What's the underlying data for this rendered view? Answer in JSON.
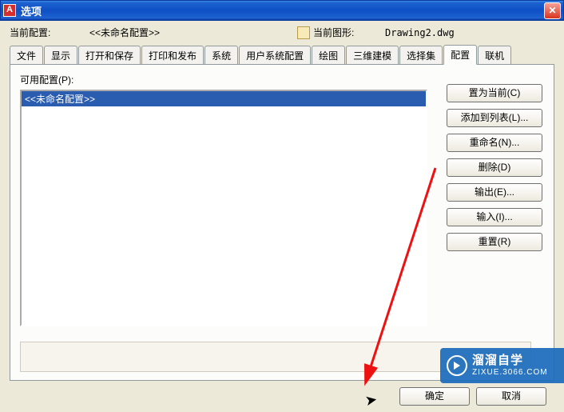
{
  "title": "选项",
  "info": {
    "current_profile_label": "当前配置:",
    "current_profile_value": "<<未命名配置>>",
    "current_drawing_label": "当前图形:",
    "current_drawing_value": "Drawing2.dwg"
  },
  "tabs": {
    "items": [
      "文件",
      "显示",
      "打开和保存",
      "打印和发布",
      "系统",
      "用户系统配置",
      "绘图",
      "三维建模",
      "选择集",
      "配置",
      "联机"
    ],
    "active_index": 9
  },
  "panel": {
    "available_label": "可用配置(P):",
    "list_items": [
      "<<未命名配置>>"
    ]
  },
  "side_buttons": {
    "set_current": "置为当前(C)",
    "add_to_list": "添加到列表(L)...",
    "rename": "重命名(N)...",
    "delete": "删除(D)",
    "export": "输出(E)...",
    "import": "输入(I)...",
    "reset": "重置(R)"
  },
  "dialog_buttons": {
    "ok": "确定",
    "cancel": "取消"
  },
  "watermark": {
    "name": "溜溜自学",
    "url": "ZIXUE.3066.COM"
  }
}
